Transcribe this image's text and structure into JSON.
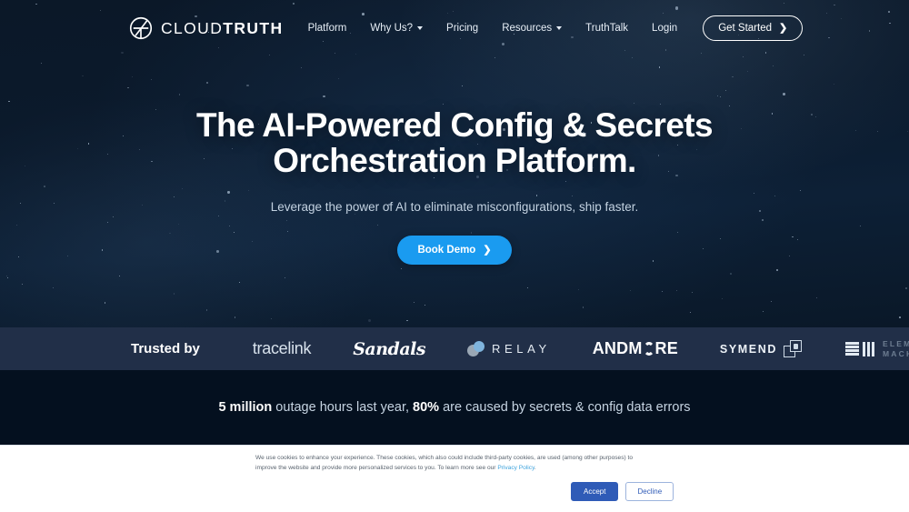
{
  "brand": {
    "logo_icon": "cloudtruth-circle-logo-icon",
    "name_light": "CLOUD",
    "name_bold": "TRUTH"
  },
  "nav": {
    "links": [
      {
        "label": "Platform",
        "has_dropdown": false
      },
      {
        "label": "Why Us?",
        "has_dropdown": true
      },
      {
        "label": "Pricing",
        "has_dropdown": false
      },
      {
        "label": "Resources",
        "has_dropdown": true
      },
      {
        "label": "TruthTalk",
        "has_dropdown": false
      }
    ],
    "login_label": "Login",
    "get_started_label": "Get Started",
    "get_started_chevron": "chevron-right-icon"
  },
  "hero": {
    "headline_line1": "The AI-Powered Config & Secrets",
    "headline_line2": "Orchestration Platform.",
    "subhead": "Leverage the power of AI to eliminate misconfigurations, ship faster.",
    "cta_label": "Book Demo",
    "cta_chevron": "chevron-right-icon",
    "cta_color": "#1a9bf0",
    "background_color": "#0b1a2c"
  },
  "trusted": {
    "label": "Trusted by",
    "background_color": "#212f48",
    "logos": [
      {
        "name": "tracelink",
        "text": "tracelink"
      },
      {
        "name": "sandals",
        "text": "Sandals"
      },
      {
        "name": "relay",
        "text": "RELAY"
      },
      {
        "name": "andmore",
        "text_before": "ANDM",
        "text_after": "RE"
      },
      {
        "name": "symend",
        "text": "SYMEND"
      },
      {
        "name": "element-machines",
        "text_line1": "ELEMENT",
        "text_line2": "MACHINES"
      }
    ]
  },
  "stat": {
    "highlight1": "5 million",
    "middle": " outage hours last year, ",
    "highlight2": "80%",
    "tail": " are caused by secrets & config data errors",
    "background_color": "#04101f"
  },
  "cookie": {
    "body": "We use cookies to enhance your experience. These cookies, which also could include third-party cookies, are used (among other purposes) to improve the website and provide more personalized services to you. To learn more see our ",
    "privacy_link": "Privacy Policy",
    "body_end": ".",
    "accept_label": "Accept",
    "decline_label": "Decline",
    "accept_color": "#2f5bb7"
  }
}
